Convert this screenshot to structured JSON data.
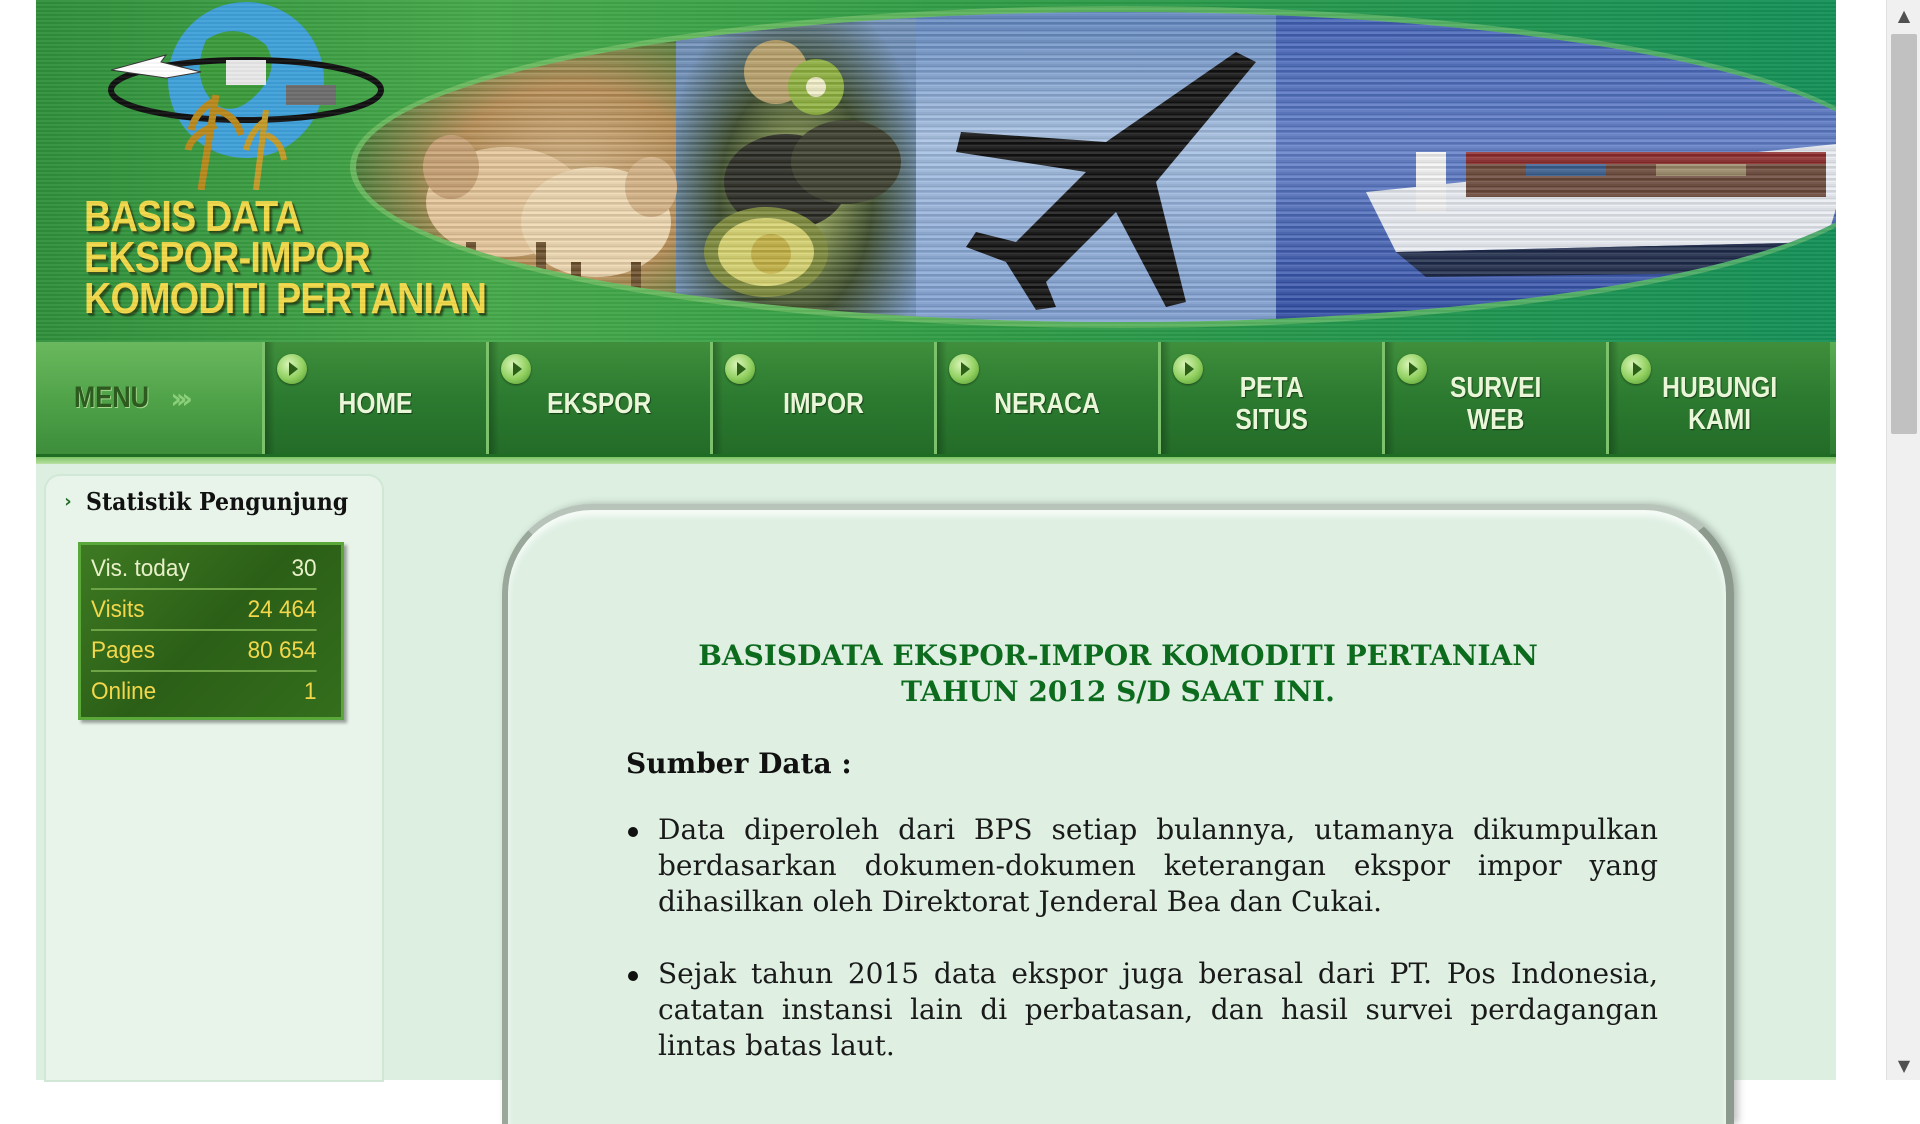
{
  "banner": {
    "title_lines": [
      "BASIS DATA",
      "EKSPOR-IMPOR",
      "KOMODITI PERTANIAN"
    ]
  },
  "menu": {
    "label": "MENU",
    "items": [
      {
        "label": "HOME"
      },
      {
        "label": "EKSPOR"
      },
      {
        "label": "IMPOR"
      },
      {
        "label": "NERACA"
      },
      {
        "label": "PETA\nSITUS"
      },
      {
        "label": "SURVEI\nWEB"
      },
      {
        "label": "HUBUNGI\nKAMI"
      }
    ]
  },
  "sidebar": {
    "title": "Statistik Pengunjung",
    "stats": [
      {
        "label": "Vis. today",
        "value": "30"
      },
      {
        "label": "Visits",
        "value": "24 464"
      },
      {
        "label": "Pages",
        "value": "80 654"
      },
      {
        "label": "Online",
        "value": "1"
      }
    ]
  },
  "main": {
    "heading_lines": [
      "BASISDATA EKSPOR-IMPOR KOMODITI PERTANIAN",
      "TAHUN 2012 S/D SAAT INI."
    ],
    "source_title": "Sumber Data :",
    "source_items": [
      "Data diperoleh dari BPS setiap bulannya, utamanya dikumpulkan berdasarkan dokumen-dokumen keterangan ekspor impor yang dihasilkan oleh Direktorat Jenderal Bea dan Cukai.",
      "Sejak tahun 2015 data ekspor juga berasal dari PT. Pos Indonesia, catatan instansi lain di perbatasan, dan hasil survei perdagangan lintas batas laut."
    ]
  },
  "colors": {
    "heading_green": "#0d6b1e",
    "menu_green": "#2c7a30",
    "banner_title_yellow": "#f1d84a",
    "stats_yellow": "#f3d74a",
    "page_background": "#dcefe0"
  },
  "icons": {
    "menu_item": "arrow-circle-icon",
    "sidebar_header": "chevron-right-icon",
    "scroll_up": "triangle-up-icon",
    "scroll_down": "triangle-down-icon"
  }
}
